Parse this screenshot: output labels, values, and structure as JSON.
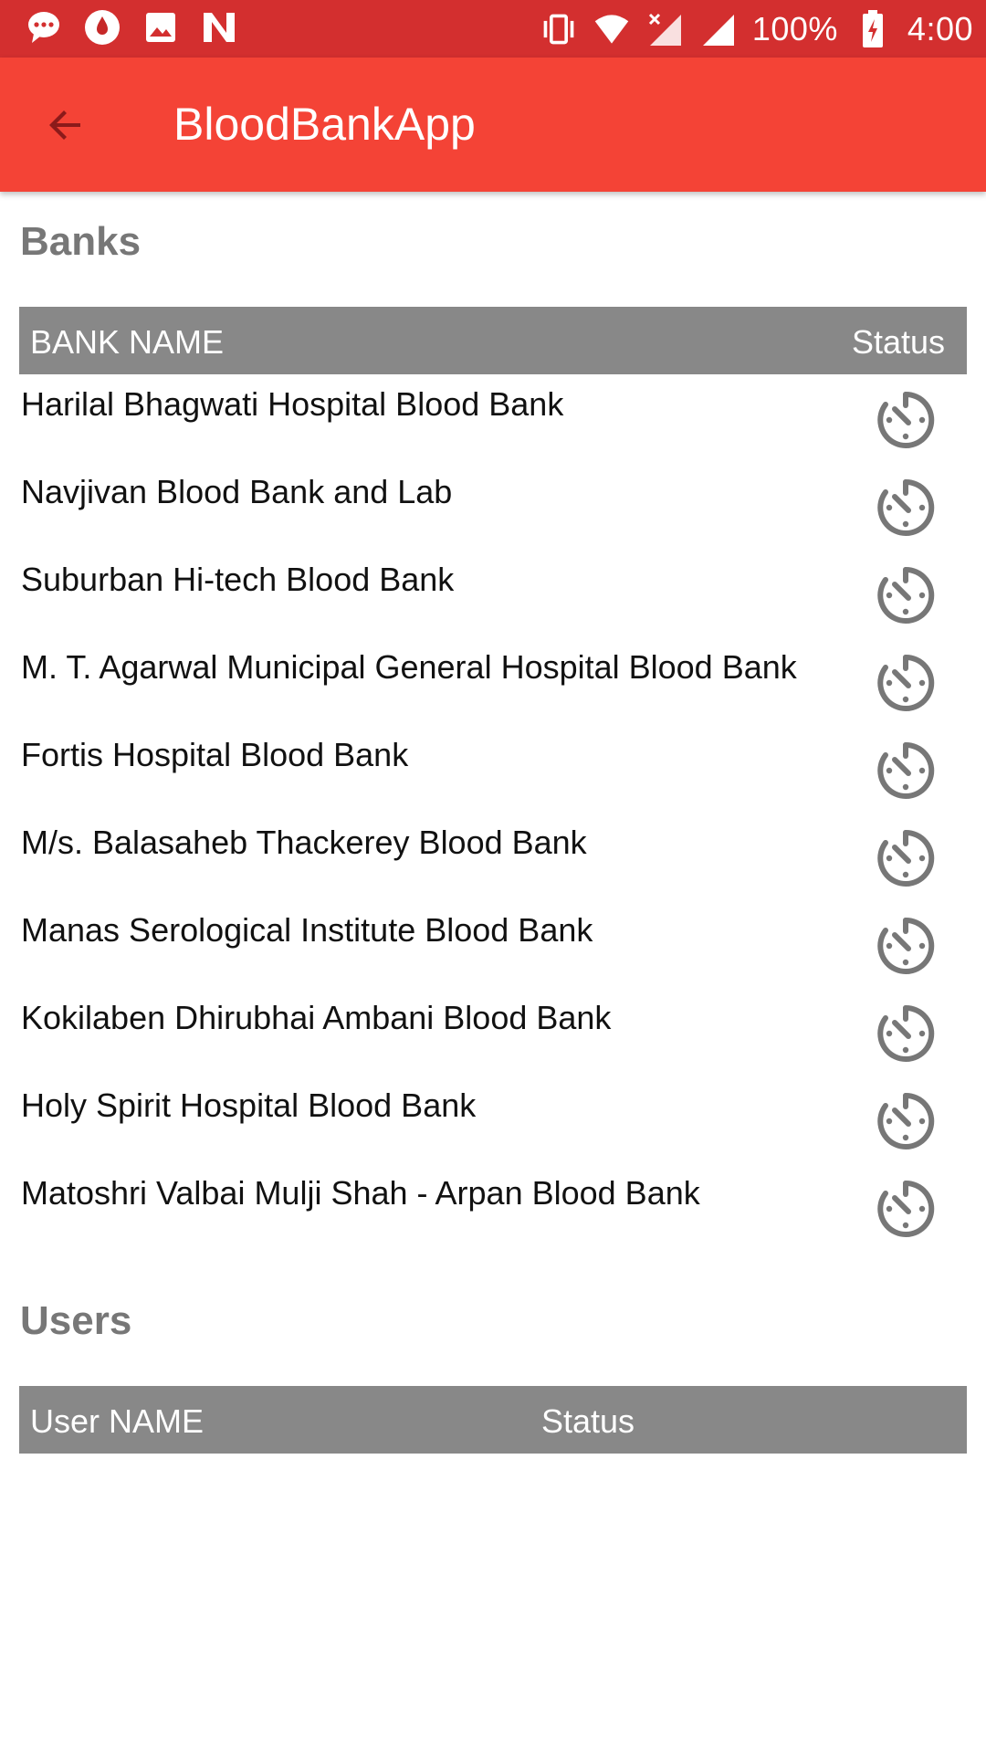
{
  "status_bar": {
    "icons_left": [
      "message-icon",
      "app-icon",
      "image-icon",
      "n-icon"
    ],
    "icons_right": [
      "vibrate-icon",
      "wifi-icon",
      "no-sim-signal-icon",
      "cell-signal-icon"
    ],
    "battery": "100%",
    "time": "4:00"
  },
  "app_bar": {
    "title": "BloodBankApp",
    "back_icon": "arrow-back-icon"
  },
  "banks": {
    "title": "Banks",
    "columns": {
      "name": "BANK NAME",
      "status": "Status"
    },
    "rows": [
      {
        "name": "Harilal Bhagwati Hospital Blood Bank",
        "status_icon": "timer-icon"
      },
      {
        "name": "Navjivan Blood Bank and Lab",
        "status_icon": "timer-icon"
      },
      {
        "name": "Suburban Hi-tech Blood Bank",
        "status_icon": "timer-icon"
      },
      {
        "name": "M. T. Agarwal Municipal General Hospital Blood Bank",
        "status_icon": "timer-icon"
      },
      {
        "name": "Fortis Hospital Blood Bank",
        "status_icon": "timer-icon"
      },
      {
        "name": "M/s. Balasaheb Thackerey Blood Bank",
        "status_icon": "timer-icon"
      },
      {
        "name": "Manas Serological Institute Blood Bank",
        "status_icon": "timer-icon"
      },
      {
        "name": "Kokilaben Dhirubhai Ambani Blood Bank",
        "status_icon": "timer-icon"
      },
      {
        "name": "Holy Spirit Hospital Blood Bank",
        "status_icon": "timer-icon"
      },
      {
        "name": "Matoshri Valbai Mulji Shah - Arpan Blood Bank",
        "status_icon": "timer-icon"
      }
    ]
  },
  "users": {
    "title": "Users",
    "columns": {
      "name": "User NAME",
      "status": "Status"
    },
    "rows": []
  },
  "colors": {
    "status_bar": "#d32f2f",
    "app_bar": "#f44336",
    "table_header": "#888888",
    "section_title": "#777777",
    "status_icon": "#777777"
  }
}
